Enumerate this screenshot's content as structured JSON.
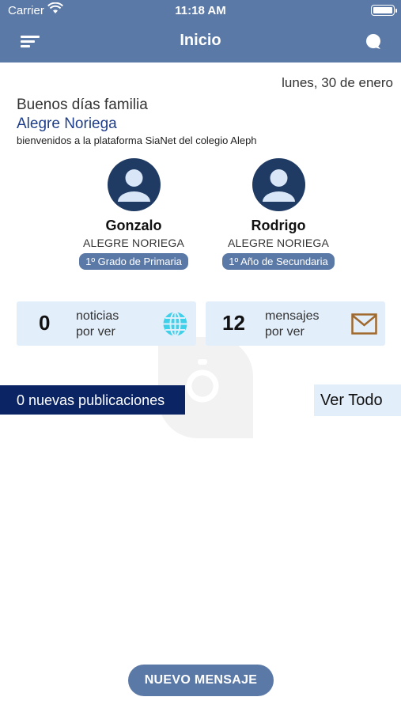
{
  "status_bar": {
    "carrier": "Carrier",
    "time": "11:18 AM"
  },
  "nav": {
    "title": "Inicio",
    "menu_icon": "menu-lines-icon",
    "chat_icon": "chat-bubble-icon"
  },
  "date": "lunes, 30 de enero",
  "greeting": {
    "line1": "Buenos días familia",
    "family": "Alegre Noriega",
    "welcome": "bienvenidos a la plataforma SiaNet del colegio Aleph"
  },
  "students": [
    {
      "first_name": "Gonzalo",
      "last_name": "ALEGRE NORIEGA",
      "grade": "1º Grado de Primaria",
      "icon": "person-avatar-icon"
    },
    {
      "first_name": "Rodrigo",
      "last_name": "ALEGRE NORIEGA",
      "grade": "1º Año de Secundaria",
      "icon": "person-avatar-icon"
    }
  ],
  "summary": {
    "news": {
      "count": "0",
      "label_line1": "noticias",
      "label_line2": "por ver",
      "icon": "globe-icon"
    },
    "messages": {
      "count": "12",
      "label_line1": "mensajes",
      "label_line2": "por ver",
      "icon": "envelope-icon"
    }
  },
  "publications": {
    "new_label": "0 nuevas publicaciones",
    "see_all": "Ver Todo"
  },
  "actions": {
    "new_message": "NUEVO MENSAJE"
  },
  "colors": {
    "header": "#5b79a6",
    "accent_dark": "#0b2463",
    "card_bg": "#e3eefb",
    "avatar": "#1f3a63",
    "globe": "#3fd0ea",
    "envelope": "#a0692e"
  }
}
